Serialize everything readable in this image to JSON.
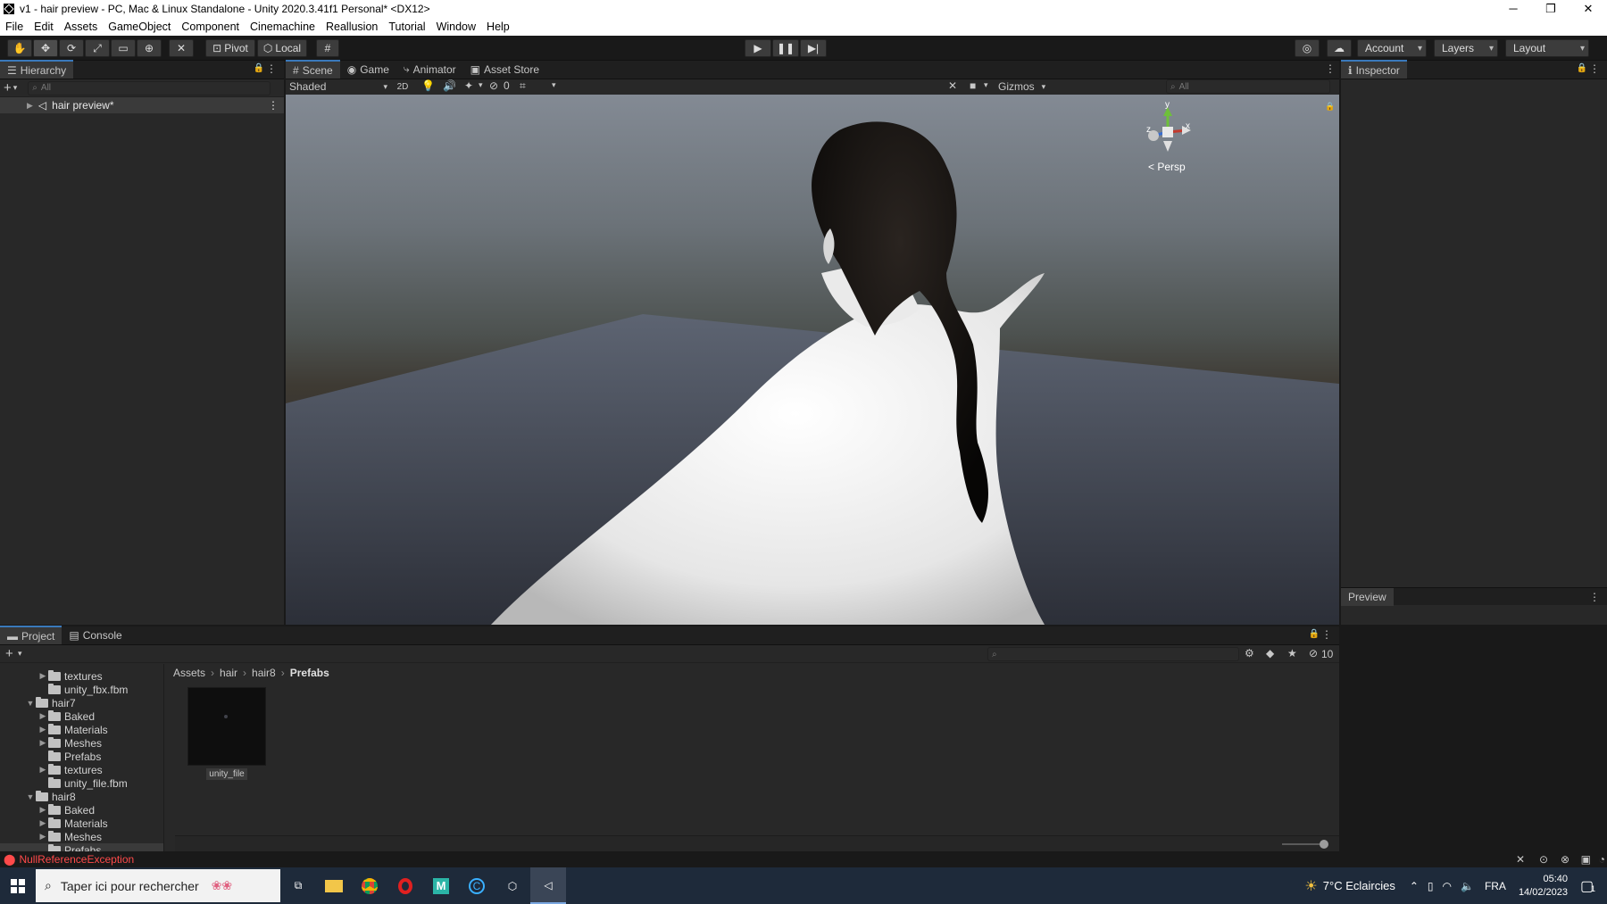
{
  "window": {
    "title": "v1 - hair preview - PC, Mac & Linux Standalone - Unity 2020.3.41f1 Personal* <DX12>"
  },
  "menu": [
    "File",
    "Edit",
    "Assets",
    "GameObject",
    "Component",
    "Cinemachine",
    "Reallusion",
    "Tutorial",
    "Window",
    "Help"
  ],
  "toolbar": {
    "pivot": "Pivot",
    "local": "Local",
    "account": "Account",
    "layers": "Layers",
    "layout": "Layout"
  },
  "hierarchy": {
    "tab": "Hierarchy",
    "search_placeholder": "All",
    "scene_item": "hair preview*"
  },
  "scene_tabs": {
    "scene": "Scene",
    "game": "Game",
    "animator": "Animator",
    "asset_store": "Asset Store"
  },
  "scene_toolbar": {
    "shading": "Shaded",
    "mode_2d": "2D",
    "hidden_count": "0",
    "gizmos": "Gizmos",
    "search_placeholder": "All"
  },
  "gizmo": {
    "y": "y",
    "x": "x",
    "z": "z",
    "persp": "< Persp"
  },
  "inspector": {
    "tab": "Inspector",
    "preview": "Preview"
  },
  "project": {
    "tab_project": "Project",
    "tab_console": "Console",
    "visible_count": "10",
    "breadcrumb": [
      "Assets",
      "hair",
      "hair8",
      "Prefabs"
    ],
    "tree": [
      {
        "label": "textures",
        "indent": 2,
        "arrow": "▶"
      },
      {
        "label": "unity_fbx.fbm",
        "indent": 2,
        "arrow": ""
      },
      {
        "label": "hair7",
        "indent": 1,
        "arrow": "▼"
      },
      {
        "label": "Baked",
        "indent": 2,
        "arrow": "▶"
      },
      {
        "label": "Materials",
        "indent": 2,
        "arrow": "▶"
      },
      {
        "label": "Meshes",
        "indent": 2,
        "arrow": "▶"
      },
      {
        "label": "Prefabs",
        "indent": 2,
        "arrow": ""
      },
      {
        "label": "textures",
        "indent": 2,
        "arrow": "▶"
      },
      {
        "label": "unity_file.fbm",
        "indent": 2,
        "arrow": ""
      },
      {
        "label": "hair8",
        "indent": 1,
        "arrow": "▼"
      },
      {
        "label": "Baked",
        "indent": 2,
        "arrow": "▶"
      },
      {
        "label": "Materials",
        "indent": 2,
        "arrow": "▶"
      },
      {
        "label": "Meshes",
        "indent": 2,
        "arrow": "▶"
      },
      {
        "label": "Prefabs",
        "indent": 2,
        "arrow": "",
        "selected": true
      }
    ],
    "asset": {
      "name": "unity_file"
    }
  },
  "status": {
    "error": "NullReferenceException",
    "error_color": "#ff4a4a"
  },
  "taskbar": {
    "search_placeholder": "Taper ici pour rechercher",
    "weather": "7°C  Eclaircies",
    "language": "FRA",
    "time": "05:40",
    "date": "14/02/2023",
    "notification_count": "1"
  }
}
